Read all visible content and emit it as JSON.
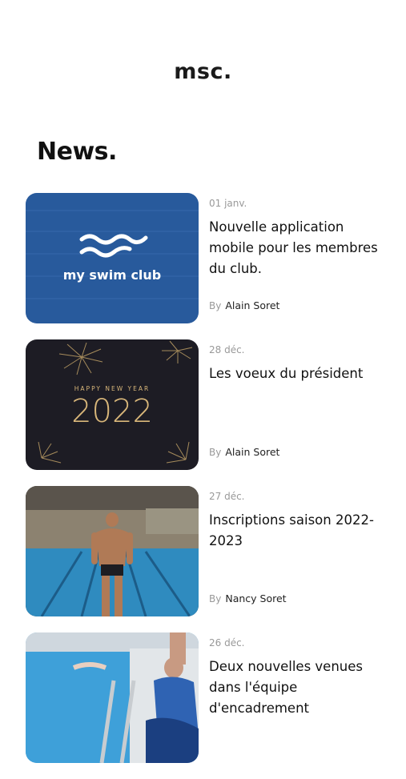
{
  "brand": {
    "logo_text": "msc."
  },
  "section": {
    "title": "News."
  },
  "news": [
    {
      "date": "01 janv.",
      "title": "Nouvelle application mobile pour les membres du club.",
      "by_label": "By",
      "author": "Alain Soret",
      "thumb_text": "my swim club"
    },
    {
      "date": "28 déc.",
      "title": "Les voeux du président",
      "by_label": "By",
      "author": "Alain Soret",
      "thumb_text_top": "HAPPY NEW YEAR",
      "thumb_text_main": "2022"
    },
    {
      "date": "27 déc.",
      "title": "Inscriptions saison 2022-2023",
      "by_label": "By",
      "author": "Nancy Soret"
    },
    {
      "date": "26 déc.",
      "title": "Deux nouvelles venues dans l'équipe d'encadrement",
      "by_label": "By",
      "author": ""
    }
  ],
  "colors": {
    "swim_blue": "#2b5ea1",
    "gold": "#d9b77a",
    "dark_night": "#1d1c24"
  }
}
